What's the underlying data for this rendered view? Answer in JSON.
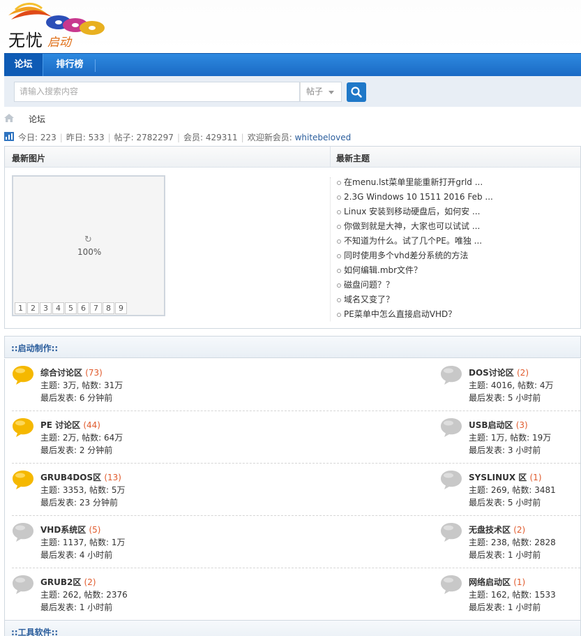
{
  "logo": {
    "main": "无忧",
    "sub": "启动"
  },
  "nav": {
    "items": [
      {
        "label": "论坛"
      },
      {
        "label": "排行榜"
      }
    ]
  },
  "search": {
    "placeholder": "请输入搜索内容",
    "type": "帖子"
  },
  "breadcrumb": {
    "current": "论坛"
  },
  "stats": {
    "today": "今日: 223",
    "yesterday": "昨日: 533",
    "posts": "帖子: 2782297",
    "members": "会员: 429311",
    "welcome": "欢迎新会员:",
    "new_member": "whitebeloved"
  },
  "latest": {
    "images_title": "最新图片",
    "topics_title": "最新主题",
    "loading": "100%",
    "pages": [
      "1",
      "2",
      "3",
      "4",
      "5",
      "6",
      "7",
      "8",
      "9"
    ],
    "topics": [
      "在menu.lst菜单里能重新打开grld ...",
      "2.3G Windows 10 1511 2016 Feb ...",
      "Linux 安装到移动硬盘后，如何安 ...",
      "你做到就是大神，大家也可以试试 ...",
      "不知道为什么。试了几个PE。唯独 ...",
      "同时使用多个vhd差分系统的方法",
      "如何编辑.mbr文件？",
      "磁盘问题？？",
      "域名又变了？",
      "PE菜单中怎么直接启动VHD？"
    ]
  },
  "section1": {
    "title": "::启动制作::"
  },
  "section2": {
    "title": "::工具软件::"
  },
  "forums": [
    {
      "name": "综合讨论区",
      "count": "(73)",
      "stats": "主题: 3万, 帖数: 31万",
      "last": "最后发表: 6 分钟前",
      "new": true
    },
    {
      "name": "DOS讨论区",
      "count": "(2)",
      "stats": "主题: 4016, 帖数: 4万",
      "last": "最后发表: 5 小时前",
      "new": false
    },
    {
      "name": "PE 讨论区",
      "count": "(44)",
      "stats": "主题: 2万, 帖数: 64万",
      "last": "最后发表: 2 分钟前",
      "new": true
    },
    {
      "name": "USB启动区",
      "count": "(3)",
      "stats": "主题: 1万, 帖数: 19万",
      "last": "最后发表: 3 小时前",
      "new": false
    },
    {
      "name": "GRUB4DOS区",
      "count": "(13)",
      "stats": "主题: 3353, 帖数: 5万",
      "last": "最后发表: 23 分钟前",
      "new": true
    },
    {
      "name": "SYSLINUX 区",
      "count": "(1)",
      "stats": "主题: 269, 帖数: 3481",
      "last": "最后发表: 5 小时前",
      "new": false
    },
    {
      "name": "VHD系统区",
      "count": "(5)",
      "stats": "主题: 1137, 帖数: 1万",
      "last": "最后发表: 4 小时前",
      "new": false
    },
    {
      "name": "无盘技术区",
      "count": "(2)",
      "stats": "主题: 238, 帖数: 2828",
      "last": "最后发表: 1 小时前",
      "new": false
    },
    {
      "name": "GRUB2区",
      "count": "(2)",
      "stats": "主题: 262, 帖数: 2376",
      "last": "最后发表: 1 小时前",
      "new": false
    },
    {
      "name": "网络启动区",
      "count": "(1)",
      "stats": "主题: 162, 帖数: 1533",
      "last": "最后发表: 1 小时前",
      "new": false
    }
  ],
  "colors": {
    "nav": "#1a6ac4",
    "accent": "#2a5d9c",
    "count": "#e05a2c",
    "bubble_new": "#f5b800",
    "bubble_old": "#c8c8c8"
  }
}
